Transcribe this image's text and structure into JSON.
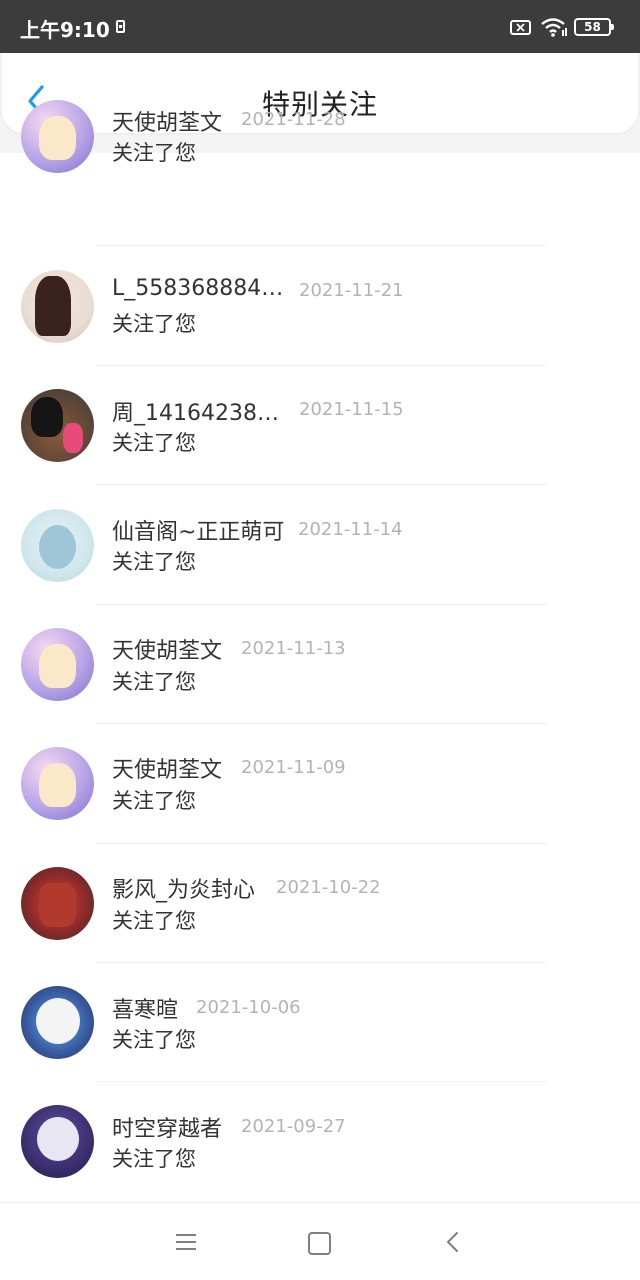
{
  "status_bar": {
    "time": "上午9:10",
    "battery": "58",
    "icons": [
      "sim-card-icon",
      "no-signal-icon",
      "wifi-icon",
      "battery-icon"
    ]
  },
  "header": {
    "title": "特别关注",
    "back_icon": "chevron-left-icon",
    "accent_color": "#1a9af2"
  },
  "follow_notices": [
    {
      "name": "天使胡荃文",
      "date": "2021-11-28",
      "action": "关注了您",
      "avatar": "angel-girl-avatar"
    },
    {
      "name": "L_558368884…",
      "date": "2021-11-21",
      "action": "关注了您",
      "avatar": "anime-girl-avatar"
    },
    {
      "name": "周_14164238…",
      "date": "2021-11-15",
      "action": "关注了您",
      "avatar": "mickey-mouse-avatar"
    },
    {
      "name": "仙音阁~正正萌可",
      "date": "2021-11-14",
      "action": "关注了您",
      "avatar": "robot-dog-avatar"
    },
    {
      "name": "天使胡荃文",
      "date": "2021-11-13",
      "action": "关注了您",
      "avatar": "angel-girl-avatar"
    },
    {
      "name": "天使胡荃文",
      "date": "2021-11-09",
      "action": "关注了您",
      "avatar": "angel-girl-avatar"
    },
    {
      "name": "影风_为炎封心",
      "date": "2021-10-22",
      "action": "关注了您",
      "avatar": "red-mech-avatar"
    },
    {
      "name": "喜寒暄",
      "date": "2021-10-06",
      "action": "关注了您",
      "avatar": "white-sheep-avatar"
    },
    {
      "name": "时空穿越者",
      "date": "2021-09-27",
      "action": "关注了您",
      "avatar": "sheep-night-avatar"
    }
  ],
  "nav_bar": {
    "icons": [
      "menu-icon",
      "home-square-icon",
      "back-chevron-icon"
    ]
  }
}
